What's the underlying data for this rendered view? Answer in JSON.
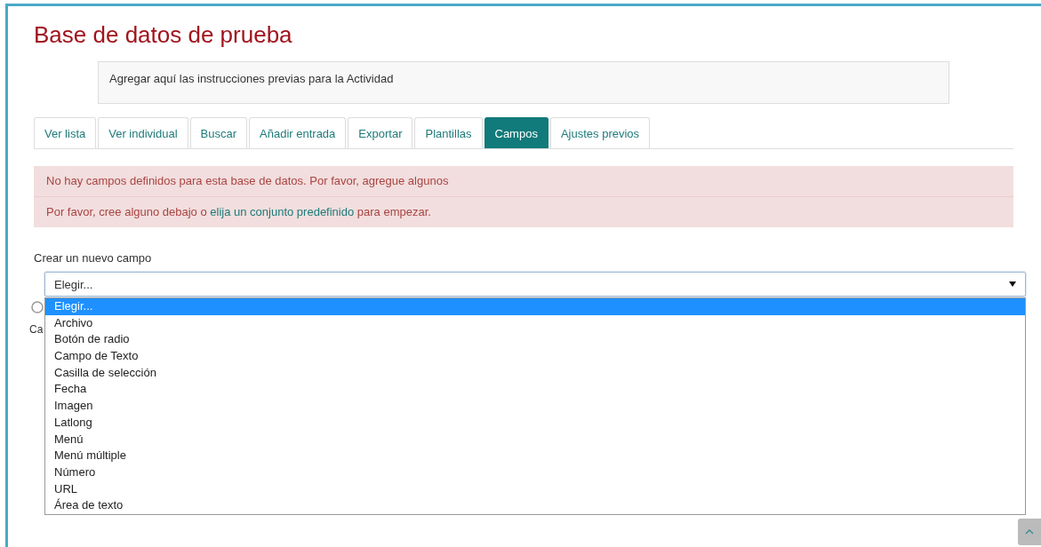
{
  "title": "Base de datos de prueba",
  "intro": "Agregar aquí las instrucciones previas para la Actividad",
  "tabs": [
    {
      "label": "Ver lista",
      "selected": false
    },
    {
      "label": "Ver individual",
      "selected": false
    },
    {
      "label": "Buscar",
      "selected": false
    },
    {
      "label": "Añadir entrada",
      "selected": false
    },
    {
      "label": "Exportar",
      "selected": false
    },
    {
      "label": "Plantillas",
      "selected": false
    },
    {
      "label": "Campos",
      "selected": true
    },
    {
      "label": "Ajustes previos",
      "selected": false
    }
  ],
  "alert": {
    "line_1": "No hay campos definidos para esta base de datos. Por favor, agregue algunos",
    "line_2_before": "Por favor, cree alguno debajo o",
    "line_2_link": "elija un conjunto predefinido",
    "line_2_after": "para empezar."
  },
  "new_field": {
    "label": "Crear un nuevo campo",
    "value": "Elegir...",
    "expanded": true,
    "options": [
      {
        "label": "Elegir...",
        "selected": true
      },
      {
        "label": "Archivo",
        "selected": false
      },
      {
        "label": "Botón de radio",
        "selected": false
      },
      {
        "label": "Campo de Texto",
        "selected": false
      },
      {
        "label": "Casilla de selección",
        "selected": false
      },
      {
        "label": "Fecha",
        "selected": false
      },
      {
        "label": "Imagen",
        "selected": false
      },
      {
        "label": "Latlong",
        "selected": false
      },
      {
        "label": "Menú",
        "selected": false
      },
      {
        "label": "Menú múltiple",
        "selected": false
      },
      {
        "label": "Número",
        "selected": false
      },
      {
        "label": "URL",
        "selected": false
      },
      {
        "label": "Área de texto",
        "selected": false
      }
    ]
  },
  "hidden_label": "Ca"
}
